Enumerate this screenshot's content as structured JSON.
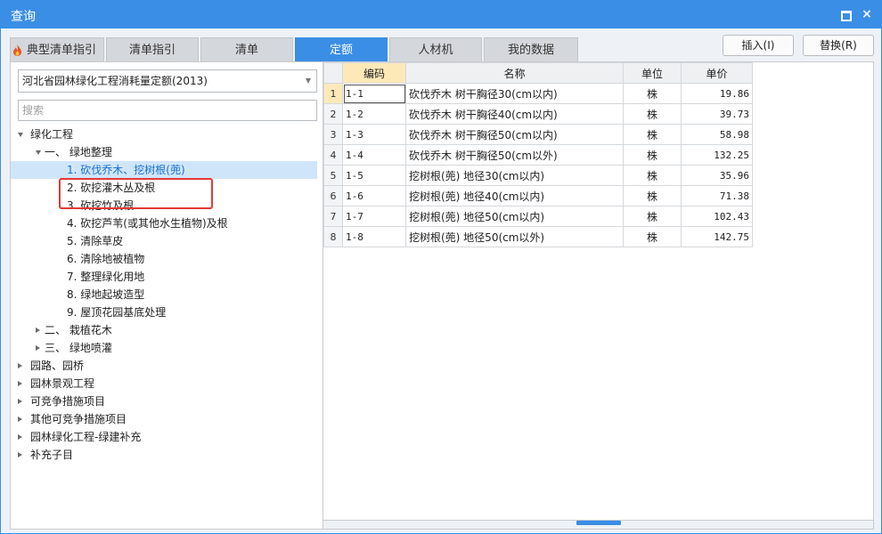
{
  "window": {
    "title": "查询",
    "maximize_icon": "maximize-icon",
    "close_icon": "close-icon",
    "close_glyph": "×"
  },
  "tabs": [
    {
      "label": "典型清单指引",
      "icon": "flame-icon"
    },
    {
      "label": "清单指引"
    },
    {
      "label": "清单"
    },
    {
      "label": "定额",
      "active": true
    },
    {
      "label": "人材机"
    },
    {
      "label": "我的数据"
    }
  ],
  "actions": {
    "insert": "插入(I)",
    "replace": "替换(R)"
  },
  "left": {
    "library": "河北省园林绿化工程消耗量定额(2013)",
    "search_placeholder": "搜索",
    "tree": [
      {
        "label": "绿化工程",
        "state": "open"
      },
      {
        "label": "一、 绿地整理",
        "state": "open"
      },
      {
        "label": "1. 砍伐乔木、挖树根(蔸)",
        "selected": true
      },
      {
        "label": "2. 砍挖灌木丛及根"
      },
      {
        "label": "3. 砍挖竹及根"
      },
      {
        "label": "4. 砍挖芦苇(或其他水生植物)及根"
      },
      {
        "label": "5. 清除草皮"
      },
      {
        "label": "6. 清除地被植物"
      },
      {
        "label": "7. 整理绿化用地"
      },
      {
        "label": "8. 绿地起坡造型"
      },
      {
        "label": "9. 屋顶花园基底处理"
      },
      {
        "label": "二、 栽植花木",
        "state": "closed"
      },
      {
        "label": "三、 绿地喷灌",
        "state": "closed"
      },
      {
        "label": "园路、园桥",
        "state": "closed"
      },
      {
        "label": "园林景观工程",
        "state": "closed"
      },
      {
        "label": "可竞争措施项目",
        "state": "closed"
      },
      {
        "label": "其他可竞争措施项目",
        "state": "closed"
      },
      {
        "label": "园林绿化工程-绿建补充",
        "state": "closed"
      },
      {
        "label": "补充子目",
        "state": "closed"
      }
    ]
  },
  "grid": {
    "columns": [
      "编码",
      "名称",
      "单位",
      "单价"
    ],
    "rows": [
      {
        "n": "1",
        "code": "1-1",
        "name": "砍伐乔木 树干胸径30(cm以内)",
        "unit": "株",
        "price": "19.86"
      },
      {
        "n": "2",
        "code": "1-2",
        "name": "砍伐乔木 树干胸径40(cm以内)",
        "unit": "株",
        "price": "39.73"
      },
      {
        "n": "3",
        "code": "1-3",
        "name": "砍伐乔木 树干胸径50(cm以内)",
        "unit": "株",
        "price": "58.98"
      },
      {
        "n": "4",
        "code": "1-4",
        "name": "砍伐乔木 树干胸径50(cm以外)",
        "unit": "株",
        "price": "132.25"
      },
      {
        "n": "5",
        "code": "1-5",
        "name": "挖树根(蔸) 地径30(cm以内)",
        "unit": "株",
        "price": "35.96"
      },
      {
        "n": "6",
        "code": "1-6",
        "name": "挖树根(蔸) 地径40(cm以内)",
        "unit": "株",
        "price": "71.38"
      },
      {
        "n": "7",
        "code": "1-7",
        "name": "挖树根(蔸) 地径50(cm以内)",
        "unit": "株",
        "price": "102.43"
      },
      {
        "n": "8",
        "code": "1-8",
        "name": "挖树根(蔸) 地径50(cm以外)",
        "unit": "株",
        "price": "142.75"
      }
    ]
  },
  "colors": {
    "accent": "#3a8ee6",
    "highlight": "#e53935",
    "selected_bg": "#cfe6fa",
    "sorted_header": "#fde9b8"
  }
}
